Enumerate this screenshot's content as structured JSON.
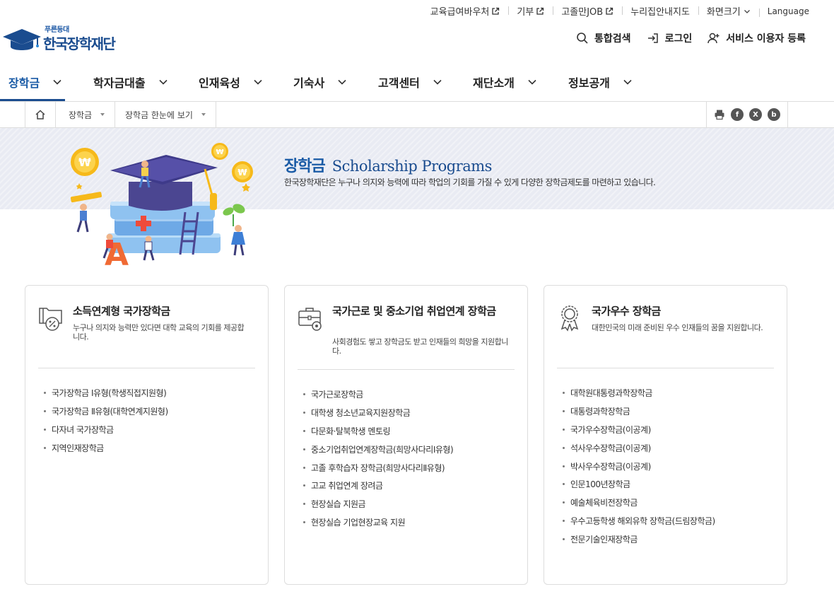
{
  "utility": {
    "links": [
      {
        "label": "교육급여바우처",
        "external": true
      },
      {
        "label": "기부",
        "external": true
      },
      {
        "label": "고졸만JOB",
        "external": true
      },
      {
        "label": "누리집안내지도",
        "external": false
      },
      {
        "label": "화면크기",
        "dropdown": true
      },
      {
        "label": "Language"
      }
    ]
  },
  "logo": {
    "sub": "푸른등대",
    "main": "한국장학재단"
  },
  "member_menu": {
    "search": "통합검색",
    "login": "로그인",
    "register": "서비스 이용자 등록"
  },
  "gnb": {
    "items": [
      "장학금",
      "학자금대출",
      "인재육성",
      "기숙사",
      "고객센터",
      "재단소개",
      "정보공개"
    ],
    "active_index": 0
  },
  "breadcrumb": {
    "items": [
      "장학금",
      "장학금 한눈에 보기"
    ],
    "share": [
      "f",
      "X",
      "b"
    ]
  },
  "banner": {
    "title_ko": "장학금",
    "title_en": "Scholarship Programs",
    "desc": "한국장학재단은 누구나 의지와 능력에 따라 학업의 기회를 가질 수 있게 다양한 장학금제도를 마련하고 있습니다."
  },
  "cards": [
    {
      "title": "소득연계형 국가장학금",
      "desc": "누구나 의지와 능력만 있다면 대학 교육의 기회를 제공합니다.",
      "icon": "folder-percent-icon",
      "items": [
        "국가장학금 Ⅰ유형(학생직접지원형)",
        "국가장학금 Ⅱ유형(대학연계지원형)",
        "다자녀 국가장학금",
        "지역인재장학금"
      ]
    },
    {
      "title": "국가근로 및 중소기업 취업연계 장학금",
      "desc": "사회경험도 쌓고 장학금도 받고 인재들의 희망을 지원합니다.",
      "icon": "briefcase-icon",
      "items": [
        "국가근로장학금",
        "대학생 청소년교육지원장학금",
        "다문화·탈북학생 멘토링",
        "중소기업취업연계장학금(희망사다리Ⅰ유형)",
        "고졸 후학습자 장학금(희망사다리Ⅱ유형)",
        "고교 취업연계 장려금",
        "현장실습 지원금",
        "현장실습 기업현장교육 지원"
      ]
    },
    {
      "title": "국가우수 장학금",
      "desc": "대한민국의 미래 준비된 우수 인재들의 꿈을 지원합니다.",
      "icon": "award-icon",
      "items": [
        "대학원대통령과학장학금",
        "대통령과학장학금",
        "국가우수장학금(이공계)",
        "석사우수장학금(이공계)",
        "박사우수장학금(이공계)",
        "인문100년장학금",
        "예술체육비전장학금",
        "우수고등학생 해외유학 장학금(드림장학금)",
        "전문기술인재장학금"
      ]
    }
  ],
  "colors": {
    "brand": "#1a4c8f",
    "accent": "#1a5ba6",
    "banner_bg": "#e9ebf3"
  }
}
